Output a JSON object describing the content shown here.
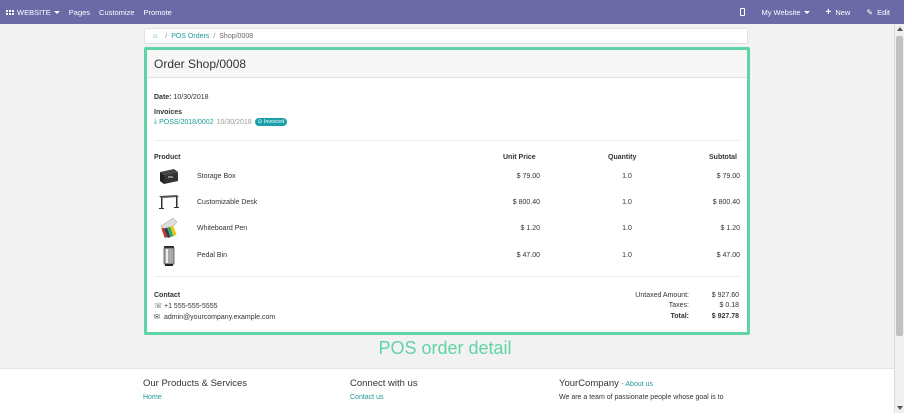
{
  "topbar": {
    "website": "WEBSITE",
    "pages": "Pages",
    "customize": "Customize",
    "promote": "Promote",
    "my_website": "My Website",
    "new": "New",
    "edit": "Edit"
  },
  "breadcrumb": {
    "link": "POS Orders",
    "current": "Shop/0008"
  },
  "order": {
    "title": "Order Shop/0008",
    "date_label": "Date:",
    "date": "10/30/2018",
    "invoices_label": "Invoices",
    "invoice_ref": "POSS/2018/0002",
    "invoice_date": "10/30/2018",
    "invoice_status": "Invoiced"
  },
  "table": {
    "headers": {
      "product": "Product",
      "unit_price": "Unit Price",
      "quantity": "Quantity",
      "subtotal": "Subtotal"
    },
    "rows": [
      {
        "icon": "storage-box-icon",
        "name": "Storage Box",
        "unit_price": "$ 79.00",
        "quantity": "1.0",
        "subtotal": "$ 79.00"
      },
      {
        "icon": "desk-icon",
        "name": "Customizable Desk",
        "unit_price": "$ 800.40",
        "quantity": "1.0",
        "subtotal": "$ 800.40"
      },
      {
        "icon": "pens-icon",
        "name": "Whiteboard Pen",
        "unit_price": "$ 1.20",
        "quantity": "1.0",
        "subtotal": "$ 1.20"
      },
      {
        "icon": "pedal-bin-icon",
        "name": "Pedal Bin",
        "unit_price": "$ 47.00",
        "quantity": "1.0",
        "subtotal": "$ 47.00"
      }
    ]
  },
  "contact": {
    "title": "Contact",
    "phone": "+1 555-555-5555",
    "email": "admin@yourcompany.example.com"
  },
  "totals": {
    "untaxed_label": "Untaxed Amount:",
    "untaxed": "$ 927.60",
    "taxes_label": "Taxes:",
    "taxes": "$ 0.18",
    "total_label": "Total:",
    "total": "$ 927.78"
  },
  "caption": "POS order detail",
  "footer": {
    "col1_title": "Our Products & Services",
    "col1_link": "Home",
    "col2_title": "Connect with us",
    "col2_link": "Contact us",
    "col3_title": "YourCompany",
    "col3_link": "About us",
    "col3_text": "We are a team of passionate people whose goal is to"
  },
  "colors": {
    "topbar": "#6b6aa6",
    "accent": "#1d9b95",
    "highlight": "#5fd4a6"
  }
}
